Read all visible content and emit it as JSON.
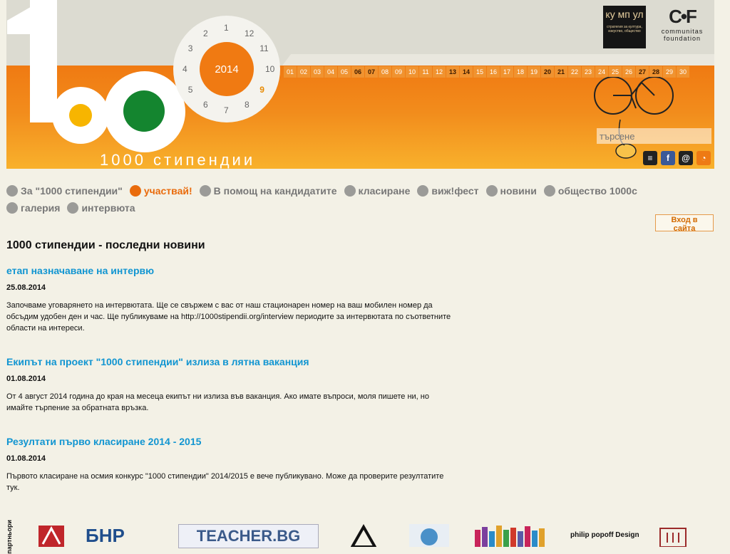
{
  "site": {
    "title": "1000 стипендии",
    "year": "2014",
    "dial_numbers": [
      "1",
      "12",
      "11",
      "10",
      "9",
      "8",
      "7",
      "6",
      "5",
      "4",
      "3",
      "2"
    ],
    "active_month": "9"
  },
  "days": [
    "01",
    "02",
    "03",
    "04",
    "05",
    "06",
    "07",
    "08",
    "09",
    "10",
    "11",
    "12",
    "13",
    "14",
    "15",
    "16",
    "17",
    "18",
    "19",
    "20",
    "21",
    "22",
    "23",
    "24",
    "25",
    "26",
    "27",
    "28",
    "29",
    "30"
  ],
  "dark_days": [
    "06",
    "07",
    "13",
    "14",
    "20",
    "21",
    "27",
    "28"
  ],
  "logos": {
    "kumpl_text": "ку мп ул",
    "kumpl_sub": "стратегия за култура, изкуство, общество",
    "communitas_mark": "C•F",
    "communitas_line1": "communitas",
    "communitas_line2": "foundation"
  },
  "search": {
    "placeholder": "търсене"
  },
  "social": [
    {
      "icon": "list-icon",
      "glyph": "≡",
      "color": "#222222"
    },
    {
      "icon": "facebook-icon",
      "glyph": "f",
      "color": "#3b5998"
    },
    {
      "icon": "email-icon",
      "glyph": "@",
      "color": "#222222"
    },
    {
      "icon": "rss-icon",
      "glyph": "◔",
      "color": "#ee7a14"
    }
  ],
  "nav": {
    "row1": [
      {
        "label": "За \"1000 стипендии\"",
        "active": false
      },
      {
        "label": "участвай!",
        "active": true
      },
      {
        "label": "В помощ на кандидатите",
        "active": false
      },
      {
        "label": "класиране",
        "active": false
      },
      {
        "label": "виж!фест",
        "active": false
      },
      {
        "label": "новини",
        "active": false
      },
      {
        "label": "общество 1000с",
        "active": false
      }
    ],
    "row2": [
      {
        "label": "галерия",
        "active": false
      },
      {
        "label": "интервюта",
        "active": false
      }
    ]
  },
  "login": {
    "label": "Вход в сайта"
  },
  "main": {
    "heading": "1000 стипендии - последни новини",
    "news": [
      {
        "title": "етап назначаване на интервю",
        "date": "25.08.2014",
        "body": "Започваме уговарянето на интервютата. Ще се свържем с вас от наш стационарен номер на ваш мобилен номер да обсъдим удобен ден и час. Ще публикуваме на http://1000stipendii.org/interview периодите за интервютата по съответните области на интереси."
      },
      {
        "title": "Екипът на проект \"1000 стипендии\" излиза в лятна ваканция",
        "date": "01.08.2014",
        "body": "От 4 август 2014 година до края на месеца екипът ни излиза във ваканция. Ако имате въпроси, моля пишете ни, но имайте търпение за обратната връзка."
      },
      {
        "title": "Резултати първо класиране 2014 - 2015",
        "date": "01.08.2014",
        "body": "Първото класиране на осмия конкурс \"1000 стипендии\" 2014/2015 е вече публикувано. Може да проверите резултатите тук."
      }
    ]
  },
  "partners": {
    "label": "партньори",
    "items": [
      "БНР",
      "TEACHER.BG",
      "philip popoff Design"
    ]
  }
}
